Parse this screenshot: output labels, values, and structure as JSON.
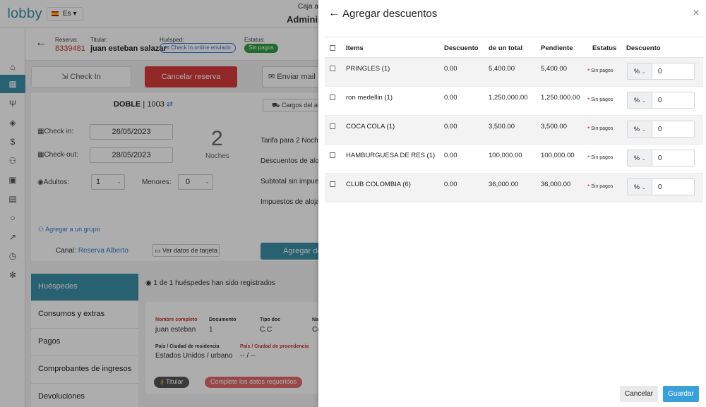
{
  "app": {
    "logo": "lobby",
    "language": "Es",
    "caja_label": "Caja a",
    "admin_label": "Adminis"
  },
  "reservation": {
    "reserva_label": "Reserva:",
    "reserva_num": "8339481",
    "titular_label": "Titular:",
    "titular_name": "juan esteban salazar",
    "huesped_label": "Huésped:",
    "huesped_status": "Check in online enviado",
    "estatus_label": "Estatus:",
    "estatus_value": "Sin pagos"
  },
  "actions": {
    "checkin": "Check In",
    "cancelar": "Cancelar reserva",
    "mail": "Enviar mail"
  },
  "room": {
    "type": "DOBLE",
    "number": "1003",
    "checkin_label": "Check in:",
    "checkin_value": "26/05/2023",
    "checkout_label": "Check-out:",
    "checkout_value": "28/05/2023",
    "nights_value": "2",
    "nights_label": "Noches",
    "adultos_label": "Adultos:",
    "adultos_value": "1",
    "menores_label": "Menores:",
    "menores_value": "0",
    "grupo_link": "Agregar a un grupo",
    "canal_label": "Canal:",
    "canal_value": "Reserva Alberto",
    "tarjeta_button": "Ver datos de tarjeta"
  },
  "tarifa": {
    "cargos_button": "Cargos del al",
    "lines": [
      "Tarifa para 2 Noche",
      "Descuentos de aloj",
      "Subtotal sin impues",
      "Impuestos de aloja"
    ],
    "agregar_button": "Agregar de"
  },
  "tabs": [
    "Huéspedes",
    "Consumos y extras",
    "Pagos",
    "Comprobantes de ingresos",
    "Devoluciones"
  ],
  "guests": {
    "count_text": "1 de 1 huéspedes han sido registrados",
    "nombre_label": "Nombre completo",
    "nombre_value": "juan esteban",
    "documento_label": "Documento",
    "documento_value": "1",
    "tipodoc_label": "Tipo doc",
    "tipodoc_value": "C.C",
    "extra_label": "Na",
    "extra_value": "Co",
    "residencia_label": "País / Ciudad de residencia",
    "residencia_value": "Estados Unidos / urbano",
    "procedencia_label": "País / Ciudad de procedencia",
    "procedencia_value": "-- / --",
    "titular_pill": "Titular",
    "complete_pill": "Complete los datos requeridos"
  },
  "drawer": {
    "title": "Agregar descuentos",
    "columns": [
      "Items",
      "Descuento",
      "de un total",
      "Pendiente",
      "Estatus",
      "Descuento"
    ],
    "rows": [
      {
        "item": "PRINGLES (1)",
        "descuento": "0.00",
        "total": "5,400.00",
        "pendiente": "5,400.00",
        "estatus": "Sin pagos",
        "tipo": "%",
        "valor": "0"
      },
      {
        "item": "ron medellin (1)",
        "descuento": "0.00",
        "total": "1,250,000.00",
        "pendiente": "1,250,000.00",
        "estatus": "Sin pagos",
        "tipo": "%",
        "valor": "0"
      },
      {
        "item": "COCA COLA (1)",
        "descuento": "0.00",
        "total": "3,500.00",
        "pendiente": "3,500.00",
        "estatus": "Sin pagos",
        "tipo": "%",
        "valor": "0"
      },
      {
        "item": "HAMBURGUESA DE RES (1)",
        "descuento": "0.00",
        "total": "100,000.00",
        "pendiente": "100,000.00",
        "estatus": "Sin pagos",
        "tipo": "%",
        "valor": "0"
      },
      {
        "item": "CLUB COLOMBIA (6)",
        "descuento": "0.00",
        "total": "36,000.00",
        "pendiente": "36,000.00",
        "estatus": "Sin pagos",
        "tipo": "%",
        "valor": "0"
      }
    ],
    "cancel_button": "Cancelar",
    "save_button": "Guardar"
  },
  "icons": [
    "home-icon",
    "calendar-icon",
    "utensils-icon",
    "box-icon",
    "dollar-icon",
    "users-icon",
    "id-card-icon",
    "clipboard-icon",
    "search-icon",
    "chart-icon",
    "clock-icon",
    "gear-icon"
  ],
  "colors": {
    "brand": "#3a8fa8",
    "danger": "#d63a3a",
    "success": "#2e9e44",
    "primary": "#3aa0da"
  }
}
